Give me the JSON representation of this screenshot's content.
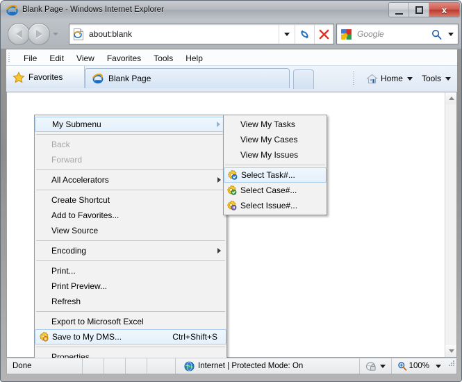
{
  "window": {
    "title": "Blank Page - Windows Internet Explorer",
    "minimize_label": "Minimize",
    "maximize_label": "Maximize",
    "close_label": "x"
  },
  "navbar": {
    "back_label": "Back",
    "forward_label": "Forward",
    "recent_pages_label": "Recent Pages",
    "address_value": "about:blank",
    "address_placeholder": "about:blank",
    "refresh_label": "Refresh",
    "stop_label": "Stop",
    "search_placeholder": "Google",
    "search_value": "",
    "search_provider": "Google",
    "search_go_label": "Search"
  },
  "menubar": {
    "items": [
      {
        "label": "File"
      },
      {
        "label": "Edit"
      },
      {
        "label": "View"
      },
      {
        "label": "Favorites"
      },
      {
        "label": "Tools"
      },
      {
        "label": "Help"
      }
    ]
  },
  "tabrow": {
    "favorites_label": "Favorites",
    "tab_label": "Blank Page",
    "newtab_label": "New Tab",
    "home_label": "Home",
    "tools_label": "Tools"
  },
  "statusbar": {
    "status": "Done",
    "zone": "Internet | Protected Mode: On",
    "zoom": "100%",
    "privacy_label": "Privacy Report"
  },
  "context_menu": {
    "items": [
      {
        "label": "My Submenu",
        "type": "submenu",
        "selected": true,
        "icon": "",
        "shortcut": ""
      },
      {
        "type": "separator"
      },
      {
        "label": "Back",
        "type": "item",
        "disabled": true,
        "icon": "",
        "shortcut": ""
      },
      {
        "label": "Forward",
        "type": "item",
        "disabled": true,
        "icon": "",
        "shortcut": ""
      },
      {
        "type": "separator"
      },
      {
        "label": "All Accelerators",
        "type": "submenu",
        "icon": "",
        "shortcut": ""
      },
      {
        "type": "separator"
      },
      {
        "label": "Create Shortcut",
        "type": "item",
        "icon": "",
        "shortcut": ""
      },
      {
        "label": "Add to Favorites...",
        "type": "item",
        "icon": "",
        "shortcut": ""
      },
      {
        "label": "View Source",
        "type": "item",
        "icon": "",
        "shortcut": ""
      },
      {
        "type": "separator"
      },
      {
        "label": "Encoding",
        "type": "submenu",
        "icon": "",
        "shortcut": ""
      },
      {
        "type": "separator"
      },
      {
        "label": "Print...",
        "type": "item",
        "icon": "",
        "shortcut": ""
      },
      {
        "label": "Print Preview...",
        "type": "item",
        "icon": "",
        "shortcut": ""
      },
      {
        "label": "Refresh",
        "type": "item",
        "icon": "",
        "shortcut": ""
      },
      {
        "type": "separator"
      },
      {
        "label": "Export to Microsoft Excel",
        "type": "item",
        "icon": "",
        "shortcut": ""
      },
      {
        "label": "Save to My DMS...",
        "type": "item",
        "icon": "dms-gear-orange-icon",
        "shortcut": "Ctrl+Shift+S",
        "selected": true
      },
      {
        "type": "separator"
      },
      {
        "label": "Properties",
        "type": "item",
        "icon": "",
        "shortcut": ""
      }
    ]
  },
  "submenu": {
    "items": [
      {
        "label": "View My Tasks",
        "type": "item",
        "icon": "",
        "shortcut": ""
      },
      {
        "label": "View My Cases",
        "type": "item",
        "icon": "",
        "shortcut": ""
      },
      {
        "label": "View My Issues",
        "type": "item",
        "icon": "",
        "shortcut": ""
      },
      {
        "type": "separator"
      },
      {
        "label": "Select Task#...",
        "type": "item",
        "icon": "dms-gear-blue-icon",
        "shortcut": "",
        "selected": true
      },
      {
        "label": "Select Case#...",
        "type": "item",
        "icon": "dms-gear-green-icon",
        "shortcut": ""
      },
      {
        "label": "Select Issue#...",
        "type": "item",
        "icon": "dms-gear-purple-icon",
        "shortcut": ""
      }
    ]
  },
  "colors": {
    "menu_bg": "#f2f2f2",
    "menu_highlight_border": "#a8cdf0",
    "titlebar": "#b4b9bf",
    "close_button": "#c0392b",
    "accent_blue": "#1f5fa9",
    "icon_yellow": "#f5c518",
    "disabled_text": "#a6a6a6"
  }
}
